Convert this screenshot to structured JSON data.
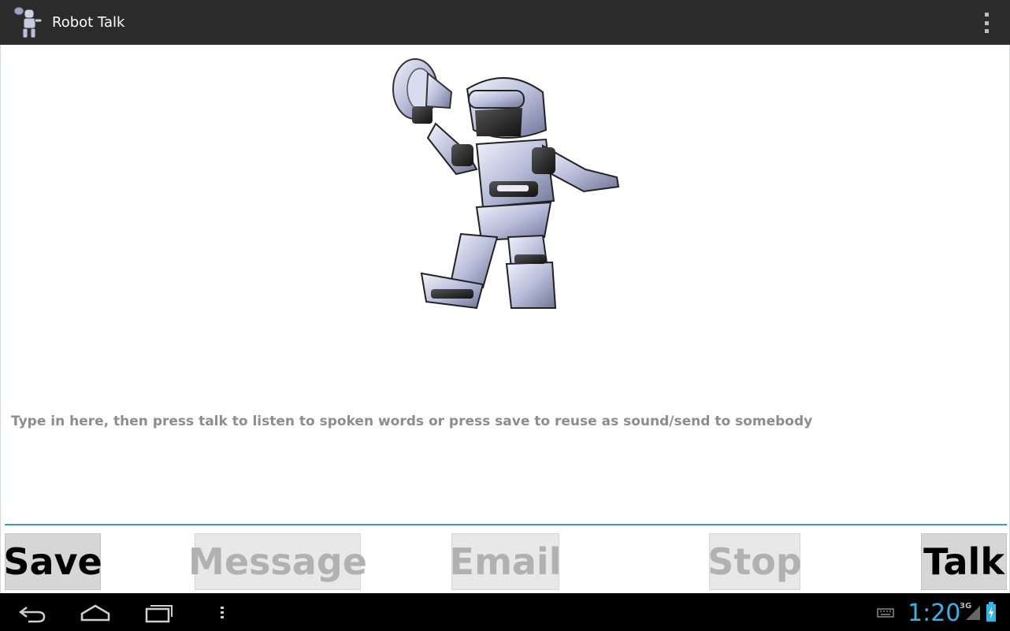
{
  "app": {
    "title": "Robot Talk"
  },
  "icons": {
    "app": "robot-megaphone-icon",
    "overflow": "overflow-menu-icon",
    "back": "back-icon",
    "home": "home-icon",
    "recents": "recent-apps-icon",
    "menu": "menu-icon",
    "keyboard": "keyboard-icon",
    "signal": "signal-icon",
    "battery": "battery-charging-icon"
  },
  "editor": {
    "value": "",
    "placeholder": "Type in here, then press talk to listen to spoken words or press save to reuse as sound/send to somebody"
  },
  "buttons": {
    "save": {
      "label": "Save"
    },
    "message": {
      "label": "Message"
    },
    "email": {
      "label": "Email"
    },
    "stop": {
      "label": "Stop"
    },
    "talk": {
      "label": "Talk"
    }
  },
  "status_bar": {
    "time": "1:20",
    "network": "3G"
  },
  "colors": {
    "accent": "#33b5e5",
    "input_underline": "#33a2b5",
    "action_bar": "#2b2b2b"
  }
}
